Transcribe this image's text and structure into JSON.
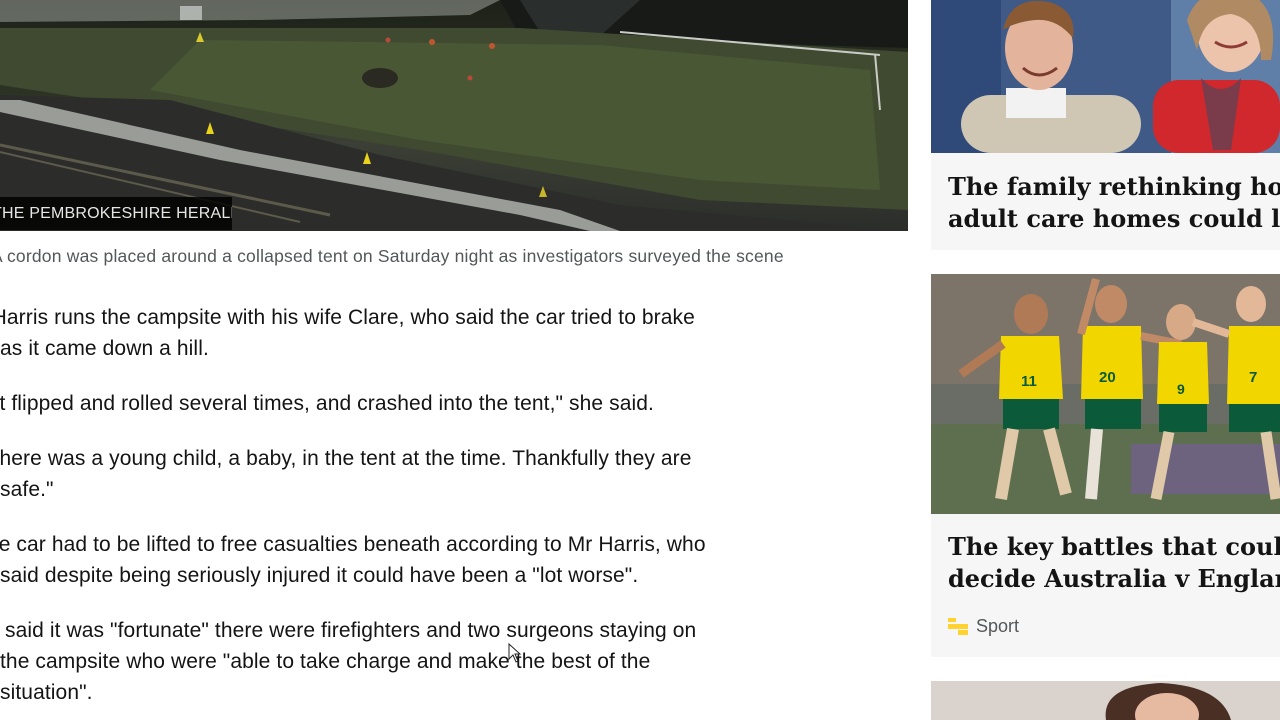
{
  "article": {
    "image_credit": "THE PEMBROKESHIRE HERALD",
    "caption": "A cordon was placed around a collapsed tent on Saturday night as investigators surveyed the scene",
    "paragraphs": [
      "Mr Harris runs the campsite with his wife Clare, who said the car tried to brake\nas it came down a hill.",
      "\"It flipped and rolled several times, and crashed into the tent,\" she said.",
      "\"There was a young child, a baby, in the tent at the time. Thankfully they are\nsafe.\"",
      "The car had to be lifted to free casualties beneath according to Mr Harris, who\nsaid despite being seriously injured it could have been a \"lot worse\".",
      "He said it was \"fortunate\" there were firefighters and two surgeons staying on\nthe campsite who were \"able to take charge and make the best of the\nsituation\"."
    ]
  },
  "sidebar": {
    "cards": [
      {
        "title_line1": "The family rethinking how",
        "title_line2": "adult care homes could look"
      },
      {
        "title_line1": "The key battles that could",
        "title_line2": "decide Australia v England",
        "tag": "Sport"
      }
    ]
  },
  "colors": {
    "sport_accent": "#ffd230",
    "australia_kit": "#f2d600",
    "australia_shorts": "#0b5a3a",
    "card_background": "#f6f6f6"
  }
}
